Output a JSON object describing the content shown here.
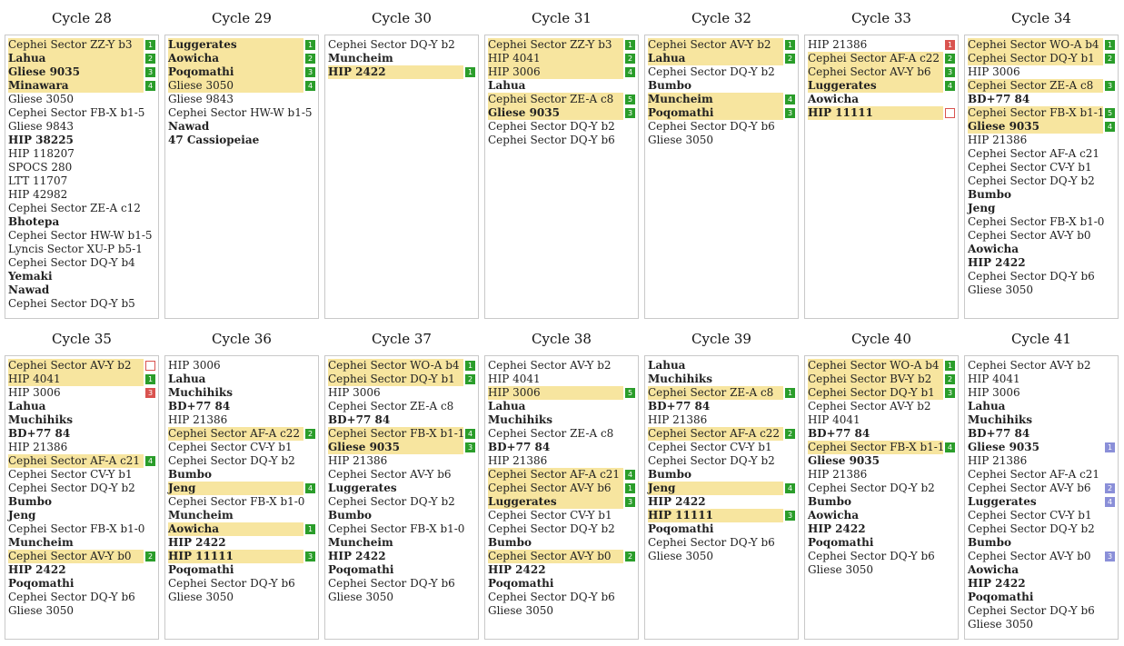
{
  "colors": {
    "highlight": "#f7e59f",
    "green": "#2a9d2a",
    "red": "#d9534f",
    "blue": "#8a8fd8"
  },
  "cycles": [
    {
      "title": "Cycle 28",
      "systems": [
        {
          "name": "Cephei Sector ZZ-Y b3",
          "hl": true,
          "badge": "1",
          "badge_color": "green"
        },
        {
          "name": "Lahua",
          "bold": true,
          "hl": true,
          "badge": "2",
          "badge_color": "green"
        },
        {
          "name": "Gliese 9035",
          "bold": true,
          "hl": true,
          "badge": "3",
          "badge_color": "green"
        },
        {
          "name": "Minawara",
          "bold": true,
          "hl": true,
          "badge": "4",
          "badge_color": "green"
        },
        {
          "name": "Gliese 3050"
        },
        {
          "name": "Cephei Sector FB-X b1-5"
        },
        {
          "name": "Gliese 9843"
        },
        {
          "name": "HIP 38225",
          "bold": true
        },
        {
          "name": "HIP 118207"
        },
        {
          "name": "SPOCS 280"
        },
        {
          "name": "LTT 11707"
        },
        {
          "name": "HIP 42982"
        },
        {
          "name": "Cephei Sector ZE-A c12"
        },
        {
          "name": "Bhotepa",
          "bold": true
        },
        {
          "name": "Cephei Sector HW-W b1-5"
        },
        {
          "name": "Lyncis Sector XU-P b5-1"
        },
        {
          "name": "Cephei Sector DQ-Y b4"
        },
        {
          "name": "Yemaki",
          "bold": true
        },
        {
          "name": "Nawad",
          "bold": true
        },
        {
          "name": "Cephei Sector DQ-Y b5"
        }
      ]
    },
    {
      "title": "Cycle 29",
      "systems": [
        {
          "name": "Luggerates",
          "bold": true,
          "hl": true,
          "badge": "1",
          "badge_color": "green"
        },
        {
          "name": "Aowicha",
          "bold": true,
          "hl": true,
          "badge": "2",
          "badge_color": "green"
        },
        {
          "name": "Poqomathi",
          "bold": true,
          "hl": true,
          "badge": "3",
          "badge_color": "green"
        },
        {
          "name": "Gliese 3050",
          "hl": true,
          "badge": "4",
          "badge_color": "green"
        },
        {
          "name": "Gliese 9843"
        },
        {
          "name": "Cephei Sector HW-W b1-5"
        },
        {
          "name": "Nawad",
          "bold": true
        },
        {
          "name": "47 Cassiopeiae",
          "bold": true
        }
      ]
    },
    {
      "title": "Cycle 30",
      "systems": [
        {
          "name": "Cephei Sector DQ-Y b2"
        },
        {
          "name": "Muncheim",
          "bold": true
        },
        {
          "name": "HIP 2422",
          "bold": true,
          "hl": true,
          "badge": "1",
          "badge_color": "green"
        }
      ]
    },
    {
      "title": "Cycle 31",
      "systems": [
        {
          "name": "Cephei Sector ZZ-Y b3",
          "hl": true,
          "badge": "1",
          "badge_color": "green"
        },
        {
          "name": "HIP 4041",
          "hl": true,
          "badge": "2",
          "badge_color": "green"
        },
        {
          "name": "HIP 3006",
          "hl": true,
          "badge": "4",
          "badge_color": "green"
        },
        {
          "name": "Lahua",
          "bold": true
        },
        {
          "name": "Cephei Sector ZE-A c8",
          "hl": true,
          "badge": "5",
          "badge_color": "green"
        },
        {
          "name": "Gliese 9035",
          "bold": true,
          "hl": true,
          "badge": "3",
          "badge_color": "green"
        },
        {
          "name": "Cephei Sector DQ-Y b2"
        },
        {
          "name": "Cephei Sector DQ-Y b6"
        }
      ]
    },
    {
      "title": "Cycle 32",
      "systems": [
        {
          "name": "Cephei Sector AV-Y b2",
          "hl": true,
          "badge": "1",
          "badge_color": "green"
        },
        {
          "name": "Lahua",
          "bold": true,
          "hl": true,
          "badge": "2",
          "badge_color": "green"
        },
        {
          "name": "Cephei Sector DQ-Y b2"
        },
        {
          "name": "Bumbo",
          "bold": true
        },
        {
          "name": "Muncheim",
          "bold": true,
          "hl": true,
          "badge": "4",
          "badge_color": "green"
        },
        {
          "name": "Poqomathi",
          "bold": true,
          "hl": true,
          "badge": "3",
          "badge_color": "green"
        },
        {
          "name": "Cephei Sector DQ-Y b6"
        },
        {
          "name": "Gliese 3050"
        }
      ]
    },
    {
      "title": "Cycle 33",
      "systems": [
        {
          "name": "HIP 21386",
          "badge": "1",
          "badge_color": "red"
        },
        {
          "name": "Cephei Sector AF-A c22",
          "hl": true,
          "badge": "2",
          "badge_color": "green"
        },
        {
          "name": "Cephei Sector AV-Y b6",
          "hl": true,
          "badge": "3",
          "badge_color": "green"
        },
        {
          "name": "Luggerates",
          "bold": true,
          "hl": true,
          "badge": "4",
          "badge_color": "green"
        },
        {
          "name": "Aowicha",
          "bold": true
        },
        {
          "name": "HIP 11111",
          "bold": true,
          "hl": true,
          "badge": "",
          "badge_color": "empty"
        }
      ]
    },
    {
      "title": "Cycle 34",
      "systems": [
        {
          "name": "Cephei Sector WO-A b4",
          "hl": true,
          "badge": "1",
          "badge_color": "green"
        },
        {
          "name": "Cephei Sector DQ-Y b1",
          "hl": true,
          "badge": "2",
          "badge_color": "green"
        },
        {
          "name": "HIP 3006"
        },
        {
          "name": "Cephei Sector ZE-A c8",
          "hl": true,
          "badge": "3",
          "badge_color": "green"
        },
        {
          "name": "BD+77 84",
          "bold": true
        },
        {
          "name": "Cephei Sector FB-X b1-1",
          "hl": true,
          "badge": "5",
          "badge_color": "green"
        },
        {
          "name": "Gliese 9035",
          "bold": true,
          "hl": true,
          "badge": "4",
          "badge_color": "green"
        },
        {
          "name": "HIP 21386"
        },
        {
          "name": "Cephei Sector AF-A c21"
        },
        {
          "name": "Cephei Sector CV-Y b1"
        },
        {
          "name": "Cephei Sector DQ-Y b2"
        },
        {
          "name": "Bumbo",
          "bold": true
        },
        {
          "name": "Jeng",
          "bold": true
        },
        {
          "name": "Cephei Sector FB-X b1-0"
        },
        {
          "name": "Cephei Sector AV-Y b0"
        },
        {
          "name": "Aowicha",
          "bold": true
        },
        {
          "name": "HIP 2422",
          "bold": true
        },
        {
          "name": "Cephei Sector DQ-Y b6"
        },
        {
          "name": "Gliese 3050"
        }
      ]
    },
    {
      "title": "Cycle 35",
      "systems": [
        {
          "name": "Cephei Sector AV-Y b2",
          "hl": true,
          "badge": "",
          "badge_color": "empty"
        },
        {
          "name": "HIP 4041",
          "hl": true,
          "badge": "1",
          "badge_color": "green"
        },
        {
          "name": "HIP 3006",
          "badge": "3",
          "badge_color": "red"
        },
        {
          "name": "Lahua",
          "bold": true
        },
        {
          "name": "Muchihiks",
          "bold": true
        },
        {
          "name": "BD+77 84",
          "bold": true
        },
        {
          "name": "HIP 21386"
        },
        {
          "name": "Cephei Sector AF-A c21",
          "hl": true,
          "badge": "4",
          "badge_color": "green"
        },
        {
          "name": "Cephei Sector CV-Y b1"
        },
        {
          "name": "Cephei Sector DQ-Y b2"
        },
        {
          "name": "Bumbo",
          "bold": true
        },
        {
          "name": "Jeng",
          "bold": true
        },
        {
          "name": "Cephei Sector FB-X b1-0"
        },
        {
          "name": "Muncheim",
          "bold": true
        },
        {
          "name": "Cephei Sector AV-Y b0",
          "hl": true,
          "badge": "2",
          "badge_color": "green"
        },
        {
          "name": "HIP 2422",
          "bold": true
        },
        {
          "name": "Poqomathi",
          "bold": true
        },
        {
          "name": "Cephei Sector DQ-Y b6"
        },
        {
          "name": "Gliese 3050"
        }
      ]
    },
    {
      "title": "Cycle 36",
      "systems": [
        {
          "name": "HIP 3006"
        },
        {
          "name": "Lahua",
          "bold": true
        },
        {
          "name": "Muchihiks",
          "bold": true
        },
        {
          "name": "BD+77 84",
          "bold": true
        },
        {
          "name": "HIP 21386"
        },
        {
          "name": "Cephei Sector AF-A c22",
          "hl": true,
          "badge": "2",
          "badge_color": "green"
        },
        {
          "name": "Cephei Sector CV-Y b1"
        },
        {
          "name": "Cephei Sector DQ-Y b2"
        },
        {
          "name": "Bumbo",
          "bold": true
        },
        {
          "name": "Jeng",
          "bold": true,
          "hl": true,
          "badge": "4",
          "badge_color": "green"
        },
        {
          "name": "Cephei Sector FB-X b1-0"
        },
        {
          "name": "Muncheim",
          "bold": true
        },
        {
          "name": "Aowicha",
          "bold": true,
          "hl": true,
          "badge": "1",
          "badge_color": "green"
        },
        {
          "name": "HIP 2422",
          "bold": true
        },
        {
          "name": "HIP 11111",
          "bold": true,
          "hl": true,
          "badge": "3",
          "badge_color": "green"
        },
        {
          "name": "Poqomathi",
          "bold": true
        },
        {
          "name": "Cephei Sector DQ-Y b6"
        },
        {
          "name": "Gliese 3050"
        }
      ]
    },
    {
      "title": "Cycle 37",
      "systems": [
        {
          "name": "Cephei Sector WO-A b4",
          "hl": true,
          "badge": "1",
          "badge_color": "green"
        },
        {
          "name": "Cephei Sector DQ-Y b1",
          "hl": true,
          "badge": "2",
          "badge_color": "green"
        },
        {
          "name": "HIP 3006"
        },
        {
          "name": "Cephei Sector ZE-A c8"
        },
        {
          "name": "BD+77 84",
          "bold": true
        },
        {
          "name": "Cephei Sector FB-X b1-1",
          "hl": true,
          "badge": "4",
          "badge_color": "green"
        },
        {
          "name": "Gliese 9035",
          "bold": true,
          "hl": true,
          "badge": "3",
          "badge_color": "green"
        },
        {
          "name": "HIP 21386"
        },
        {
          "name": "Cephei Sector AV-Y b6"
        },
        {
          "name": "Luggerates",
          "bold": true
        },
        {
          "name": "Cephei Sector DQ-Y b2"
        },
        {
          "name": "Bumbo",
          "bold": true
        },
        {
          "name": "Cephei Sector FB-X b1-0"
        },
        {
          "name": "Muncheim",
          "bold": true
        },
        {
          "name": "HIP 2422",
          "bold": true
        },
        {
          "name": "Poqomathi",
          "bold": true
        },
        {
          "name": "Cephei Sector DQ-Y b6"
        },
        {
          "name": "Gliese 3050"
        }
      ]
    },
    {
      "title": "Cycle 38",
      "systems": [
        {
          "name": "Cephei Sector AV-Y b2"
        },
        {
          "name": "HIP 4041"
        },
        {
          "name": "HIP 3006",
          "hl": true,
          "badge": "5",
          "badge_color": "green"
        },
        {
          "name": "Lahua",
          "bold": true
        },
        {
          "name": "Muchihiks",
          "bold": true
        },
        {
          "name": "Cephei Sector ZE-A c8"
        },
        {
          "name": "BD+77 84",
          "bold": true
        },
        {
          "name": "HIP 21386"
        },
        {
          "name": "Cephei Sector AF-A c21",
          "hl": true,
          "badge": "4",
          "badge_color": "green"
        },
        {
          "name": "Cephei Sector AV-Y b6",
          "hl": true,
          "badge": "1",
          "badge_color": "green"
        },
        {
          "name": "Luggerates",
          "bold": true,
          "hl": true,
          "badge": "3",
          "badge_color": "green"
        },
        {
          "name": "Cephei Sector CV-Y b1"
        },
        {
          "name": "Cephei Sector DQ-Y b2"
        },
        {
          "name": "Bumbo",
          "bold": true
        },
        {
          "name": "Cephei Sector AV-Y b0",
          "hl": true,
          "badge": "2",
          "badge_color": "green"
        },
        {
          "name": "HIP 2422",
          "bold": true
        },
        {
          "name": "Poqomathi",
          "bold": true
        },
        {
          "name": "Cephei Sector DQ-Y b6"
        },
        {
          "name": "Gliese 3050"
        }
      ]
    },
    {
      "title": "Cycle 39",
      "systems": [
        {
          "name": "Lahua",
          "bold": true
        },
        {
          "name": "Muchihiks",
          "bold": true
        },
        {
          "name": "Cephei Sector ZE-A c8",
          "hl": true,
          "badge": "1",
          "badge_color": "green"
        },
        {
          "name": "BD+77 84",
          "bold": true
        },
        {
          "name": "HIP 21386"
        },
        {
          "name": "Cephei Sector AF-A c22",
          "hl": true,
          "badge": "2",
          "badge_color": "green"
        },
        {
          "name": "Cephei Sector CV-Y b1"
        },
        {
          "name": "Cephei Sector DQ-Y b2"
        },
        {
          "name": "Bumbo",
          "bold": true
        },
        {
          "name": "Jeng",
          "bold": true,
          "hl": true,
          "badge": "4",
          "badge_color": "green"
        },
        {
          "name": "HIP 2422",
          "bold": true
        },
        {
          "name": "HIP 11111",
          "bold": true,
          "hl": true,
          "badge": "3",
          "badge_color": "green"
        },
        {
          "name": "Poqomathi",
          "bold": true
        },
        {
          "name": "Cephei Sector DQ-Y b6"
        },
        {
          "name": "Gliese 3050"
        }
      ]
    },
    {
      "title": "Cycle 40",
      "systems": [
        {
          "name": "Cephei Sector WO-A b4",
          "hl": true,
          "badge": "1",
          "badge_color": "green"
        },
        {
          "name": "Cephei Sector BV-Y b2",
          "hl": true,
          "badge": "2",
          "badge_color": "green"
        },
        {
          "name": "Cephei Sector DQ-Y b1",
          "hl": true,
          "badge": "3",
          "badge_color": "green"
        },
        {
          "name": "Cephei Sector AV-Y b2"
        },
        {
          "name": "HIP 4041"
        },
        {
          "name": "BD+77 84",
          "bold": true
        },
        {
          "name": "Cephei Sector FB-X b1-1",
          "hl": true,
          "badge": "4",
          "badge_color": "green"
        },
        {
          "name": "Gliese 9035",
          "bold": true
        },
        {
          "name": "HIP 21386"
        },
        {
          "name": "Cephei Sector DQ-Y b2"
        },
        {
          "name": "Bumbo",
          "bold": true
        },
        {
          "name": "Aowicha",
          "bold": true
        },
        {
          "name": "HIP 2422",
          "bold": true
        },
        {
          "name": "Poqomathi",
          "bold": true
        },
        {
          "name": "Cephei Sector DQ-Y b6"
        },
        {
          "name": "Gliese 3050"
        }
      ]
    },
    {
      "title": "Cycle 41",
      "systems": [
        {
          "name": "Cephei Sector AV-Y b2"
        },
        {
          "name": "HIP 4041"
        },
        {
          "name": "HIP 3006"
        },
        {
          "name": "Lahua",
          "bold": true
        },
        {
          "name": "Muchihiks",
          "bold": true
        },
        {
          "name": "BD+77 84",
          "bold": true
        },
        {
          "name": "Gliese 9035",
          "bold": true,
          "badge": "1",
          "badge_color": "blue"
        },
        {
          "name": "HIP 21386"
        },
        {
          "name": "Cephei Sector AF-A c21"
        },
        {
          "name": "Cephei Sector AV-Y b6",
          "badge": "2",
          "badge_color": "blue"
        },
        {
          "name": "Luggerates",
          "bold": true,
          "badge": "4",
          "badge_color": "blue"
        },
        {
          "name": "Cephei Sector CV-Y b1"
        },
        {
          "name": "Cephei Sector DQ-Y b2"
        },
        {
          "name": "Bumbo",
          "bold": true
        },
        {
          "name": "Cephei Sector AV-Y b0",
          "badge": "3",
          "badge_color": "blue"
        },
        {
          "name": "Aowicha",
          "bold": true
        },
        {
          "name": "HIP 2422",
          "bold": true
        },
        {
          "name": "Poqomathi",
          "bold": true
        },
        {
          "name": "Cephei Sector DQ-Y b6"
        },
        {
          "name": "Gliese 3050"
        }
      ]
    }
  ]
}
